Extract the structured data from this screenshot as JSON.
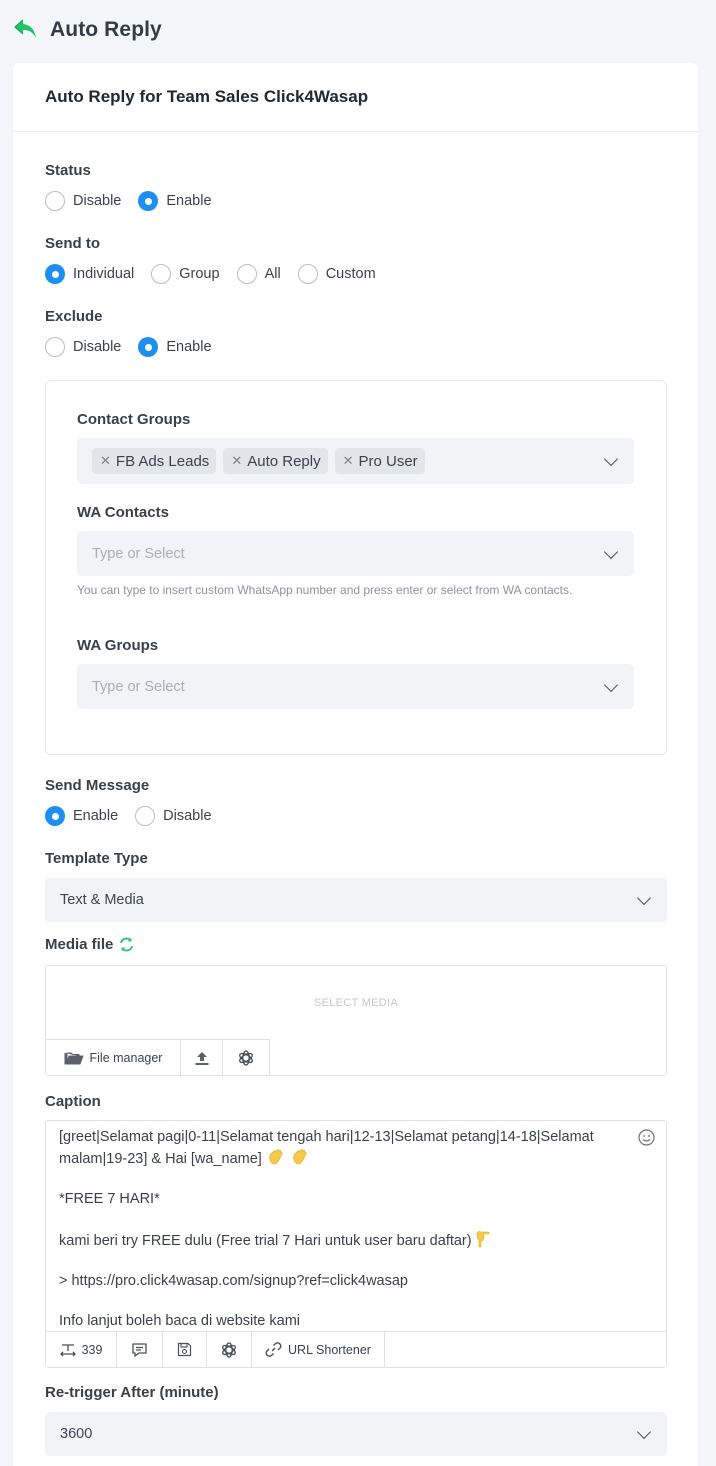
{
  "header": {
    "title": "Auto Reply",
    "icon": "reply-arrow-icon"
  },
  "card": {
    "title": "Auto Reply for Team Sales Click4Wasap"
  },
  "status": {
    "label": "Status",
    "options": [
      "Disable",
      "Enable"
    ],
    "selected": "Enable"
  },
  "send_to": {
    "label": "Send to",
    "options": [
      "Individual",
      "Group",
      "All",
      "Custom"
    ],
    "selected": "Individual"
  },
  "exclude": {
    "label": "Exclude",
    "options": [
      "Disable",
      "Enable"
    ],
    "selected": "Enable"
  },
  "exclude_panel": {
    "contact_groups": {
      "label": "Contact Groups",
      "tags": [
        "FB Ads Leads",
        "Auto Reply",
        "Pro User"
      ]
    },
    "wa_contacts": {
      "label": "WA Contacts",
      "placeholder": "Type or Select",
      "hint": "You can type to insert custom WhatsApp number and press enter or select from WA contacts."
    },
    "wa_groups": {
      "label": "WA Groups",
      "placeholder": "Type or Select"
    }
  },
  "send_message": {
    "label": "Send Message",
    "options": [
      "Enable",
      "Disable"
    ],
    "selected": "Enable"
  },
  "template_type": {
    "label": "Template Type",
    "value": "Text & Media"
  },
  "media_file": {
    "label": "Media file",
    "select_text": "SELECT MEDIA",
    "file_manager_label": "File manager"
  },
  "caption": {
    "label": "Caption",
    "lines": [
      "[greet|Selamat pagi|0-11|Selamat tengah hari|12-13|Selamat petang|14-18|Selamat malam|19-23] & Hai  [wa_name]",
      "*FREE 7 HARI*",
      "kami beri try FREE dulu (Free trial 7 Hari untuk user baru daftar)",
      "> https://pro.click4wasap.com/signup?ref=click4wasap",
      "Info lanjut boleh baca di website kami"
    ],
    "char_count": "339",
    "url_shortener_label": "URL Shortener"
  },
  "retrigger": {
    "label": "Re-trigger After (minute)",
    "value": "3600"
  },
  "colors": {
    "accent": "#1d8ff0",
    "brand_green": "#25c26e"
  }
}
